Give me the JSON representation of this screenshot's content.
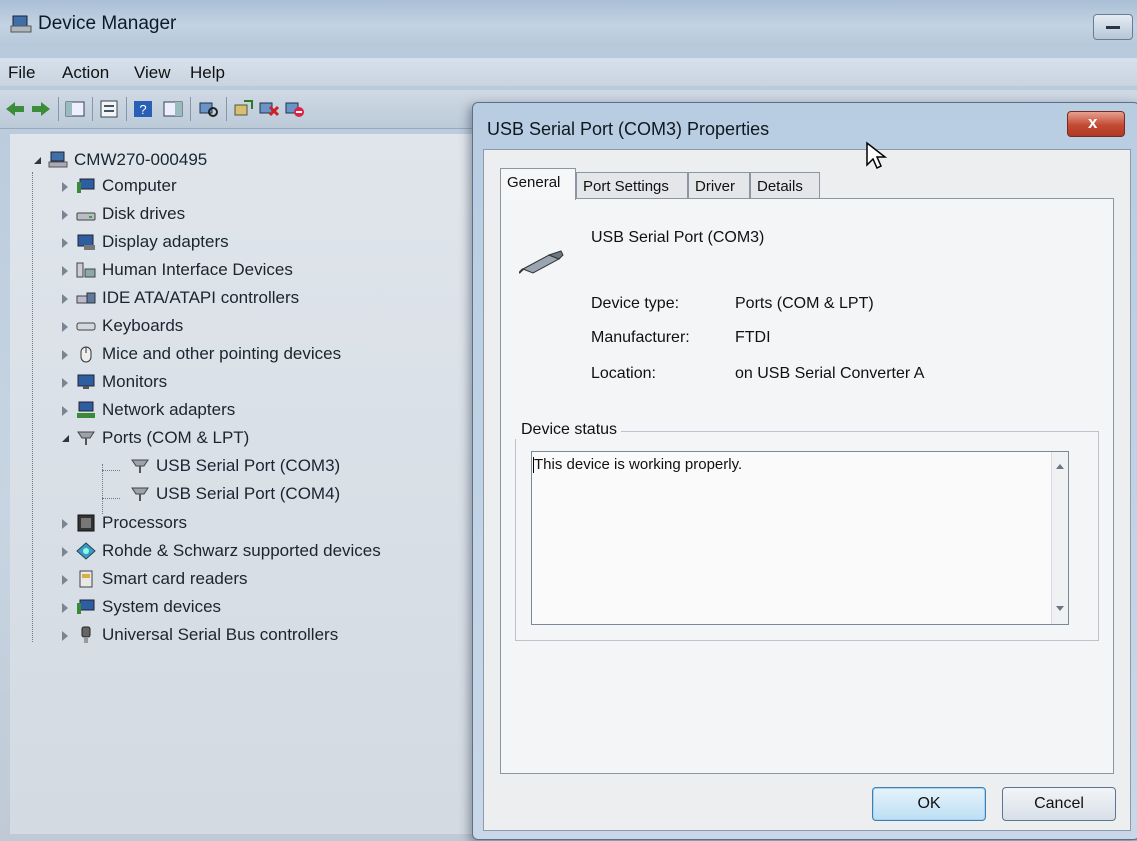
{
  "device_manager": {
    "title": "Device Manager",
    "menu": [
      "File",
      "Action",
      "View",
      "Help"
    ],
    "toolbar_icons": [
      "back-arrow-icon",
      "forward-arrow-icon",
      "show-hide-console-tree-icon",
      "properties-icon",
      "help-icon",
      "action-pane-icon",
      "scan-hardware-icon",
      "update-driver-icon",
      "uninstall-icon",
      "disable-device-icon"
    ],
    "tree": {
      "root": "CMW270-000495",
      "nodes": [
        {
          "label": "Computer",
          "expanded": false
        },
        {
          "label": "Disk drives",
          "expanded": false
        },
        {
          "label": "Display adapters",
          "expanded": false
        },
        {
          "label": "Human Interface Devices",
          "expanded": false
        },
        {
          "label": "IDE ATA/ATAPI controllers",
          "expanded": false
        },
        {
          "label": "Keyboards",
          "expanded": false
        },
        {
          "label": "Mice and other pointing devices",
          "expanded": false
        },
        {
          "label": "Monitors",
          "expanded": false
        },
        {
          "label": "Network adapters",
          "expanded": false
        },
        {
          "label": "Ports (COM & LPT)",
          "expanded": true
        },
        {
          "label": "Processors",
          "expanded": false
        },
        {
          "label": "Rohde & Schwarz supported devices",
          "expanded": false
        },
        {
          "label": "Smart card readers",
          "expanded": false
        },
        {
          "label": "System devices",
          "expanded": false
        },
        {
          "label": "Universal Serial Bus controllers",
          "expanded": false
        }
      ],
      "port_children": [
        "USB Serial Port (COM3)",
        "USB Serial Port (COM4)"
      ]
    }
  },
  "dialog": {
    "title": "USB Serial Port (COM3) Properties",
    "close_label": "x",
    "tabs": [
      "General",
      "Port Settings",
      "Driver",
      "Details"
    ],
    "active_tab": "General",
    "device_name": "USB Serial Port (COM3)",
    "properties": [
      {
        "label": "Device type:",
        "value": "Ports (COM & LPT)"
      },
      {
        "label": "Manufacturer:",
        "value": "FTDI"
      },
      {
        "label": "Location:",
        "value": "on USB Serial Converter A"
      }
    ],
    "status_legend": "Device status",
    "status_text": "This device is working properly.",
    "ok_label": "OK",
    "cancel_label": "Cancel"
  },
  "colors": {
    "window_bg": "#c7d5e2",
    "dialog_close": "#c34a32",
    "ok_border": "#3c7fb1"
  }
}
